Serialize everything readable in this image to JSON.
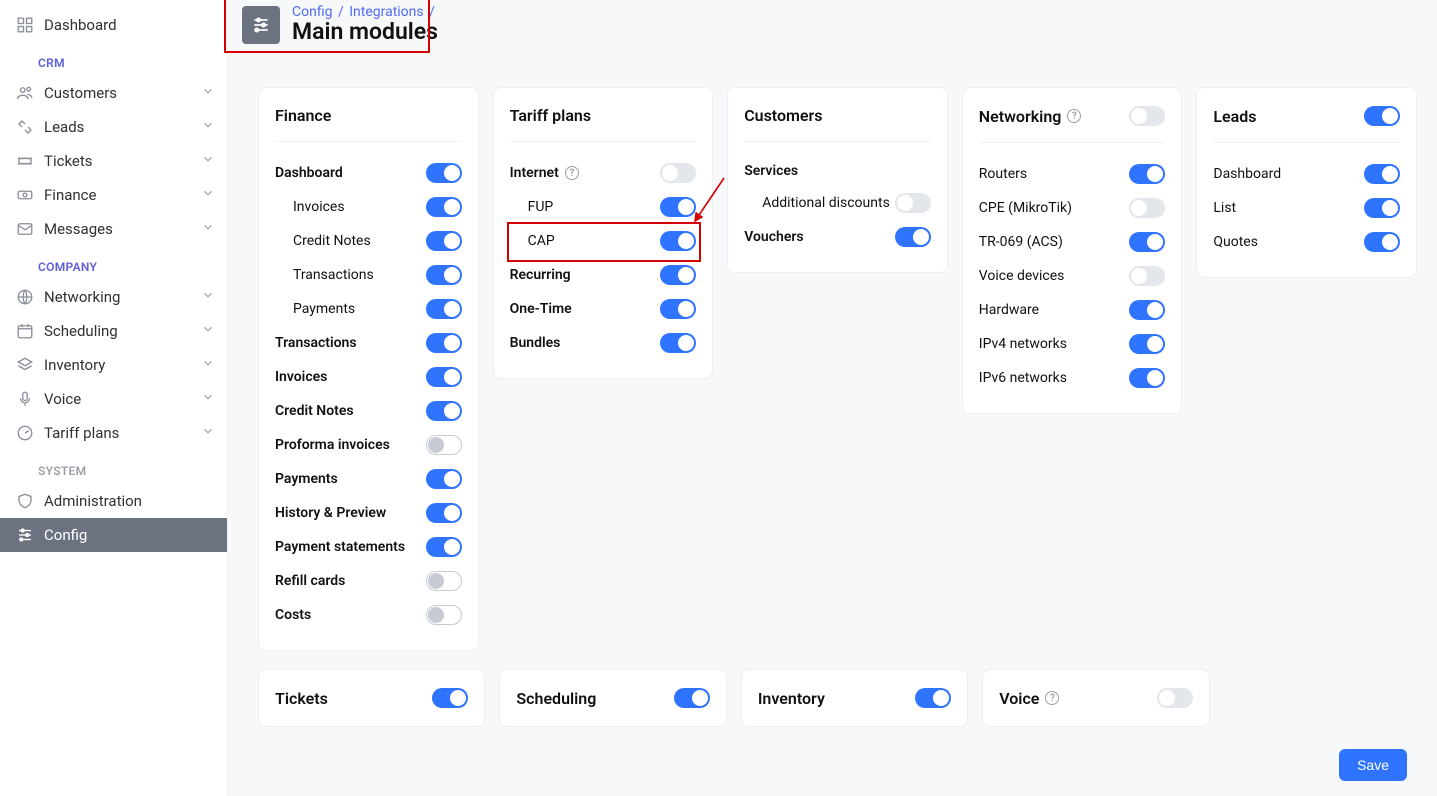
{
  "sidebar": {
    "top": {
      "label": "Dashboard"
    },
    "sections": [
      {
        "label": "CRM",
        "muted": false,
        "items": [
          {
            "label": "Customers",
            "chev": true,
            "icon": "users"
          },
          {
            "label": "Leads",
            "chev": true,
            "icon": "handshake"
          },
          {
            "label": "Tickets",
            "chev": true,
            "icon": "ticket"
          },
          {
            "label": "Finance",
            "chev": true,
            "icon": "money"
          },
          {
            "label": "Messages",
            "chev": true,
            "icon": "mail"
          }
        ]
      },
      {
        "label": "COMPANY",
        "muted": false,
        "items": [
          {
            "label": "Networking",
            "chev": true,
            "icon": "globe"
          },
          {
            "label": "Scheduling",
            "chev": true,
            "icon": "calendar"
          },
          {
            "label": "Inventory",
            "chev": true,
            "icon": "layers"
          },
          {
            "label": "Voice",
            "chev": true,
            "icon": "mic"
          },
          {
            "label": "Tariff plans",
            "chev": true,
            "icon": "gauge"
          }
        ]
      },
      {
        "label": "SYSTEM",
        "muted": true,
        "items": [
          {
            "label": "Administration",
            "chev": false,
            "icon": "shield"
          },
          {
            "label": "Config",
            "chev": false,
            "icon": "sliders",
            "active": true
          }
        ]
      }
    ]
  },
  "header": {
    "breadcrumb": [
      "Config",
      "Integrations"
    ],
    "title": "Main modules"
  },
  "cards": {
    "finance": {
      "title": "Finance",
      "items": [
        {
          "label": "Dashboard",
          "on": true,
          "indent": 0,
          "bold": true
        },
        {
          "label": "Invoices",
          "on": true,
          "indent": 1
        },
        {
          "label": "Credit Notes",
          "on": true,
          "indent": 1
        },
        {
          "label": "Transactions",
          "on": true,
          "indent": 1
        },
        {
          "label": "Payments",
          "on": true,
          "indent": 1
        },
        {
          "label": "Transactions",
          "on": true,
          "indent": 0,
          "bold": true
        },
        {
          "label": "Invoices",
          "on": true,
          "indent": 0,
          "bold": true
        },
        {
          "label": "Credit Notes",
          "on": true,
          "indent": 0,
          "bold": true
        },
        {
          "label": "Proforma invoices",
          "on": false,
          "outline": true,
          "indent": 0,
          "bold": true
        },
        {
          "label": "Payments",
          "on": true,
          "indent": 0,
          "bold": true
        },
        {
          "label": "History & Preview",
          "on": true,
          "indent": 0,
          "bold": true
        },
        {
          "label": "Payment statements",
          "on": true,
          "indent": 0,
          "bold": true
        },
        {
          "label": "Refill cards",
          "on": false,
          "outline": true,
          "indent": 0,
          "bold": true
        },
        {
          "label": "Costs",
          "on": false,
          "outline": true,
          "indent": 0,
          "bold": true
        }
      ]
    },
    "tariff": {
      "title": "Tariff plans",
      "items": [
        {
          "label": "Internet",
          "on": false,
          "indent": 0,
          "bold": true,
          "help": true
        },
        {
          "label": "FUP",
          "on": true,
          "indent": 1
        },
        {
          "label": "CAP",
          "on": true,
          "indent": 1,
          "highlight": true
        },
        {
          "label": "Recurring",
          "on": true,
          "indent": 0,
          "bold": true
        },
        {
          "label": "One-Time",
          "on": true,
          "indent": 0,
          "bold": true
        },
        {
          "label": "Bundles",
          "on": true,
          "indent": 0,
          "bold": true
        }
      ]
    },
    "customers": {
      "title": "Customers",
      "items": [
        {
          "label": "Services",
          "indent": 0,
          "bold": true,
          "notoggle": true
        },
        {
          "label": "Additional discounts",
          "on": false,
          "indent": 1
        },
        {
          "label": "Vouchers",
          "on": true,
          "indent": 0,
          "bold": true
        }
      ]
    },
    "networking": {
      "title": "Networking",
      "help": true,
      "headerToggle": false,
      "items": [
        {
          "label": "Routers",
          "on": true
        },
        {
          "label": "CPE (MikroTik)",
          "on": false
        },
        {
          "label": "TR-069 (ACS)",
          "on": true
        },
        {
          "label": "Voice devices",
          "on": false
        },
        {
          "label": "Hardware",
          "on": true
        },
        {
          "label": "IPv4 networks",
          "on": true
        },
        {
          "label": "IPv6 networks",
          "on": true
        }
      ]
    },
    "leads": {
      "title": "Leads",
      "headerToggle": true,
      "items": [
        {
          "label": "Dashboard",
          "on": true
        },
        {
          "label": "List",
          "on": true
        },
        {
          "label": "Quotes",
          "on": true
        }
      ]
    }
  },
  "smallcards": [
    {
      "title": "Tickets",
      "on": true
    },
    {
      "title": "Scheduling",
      "on": true
    },
    {
      "title": "Inventory",
      "on": true
    },
    {
      "title": "Voice",
      "on": false,
      "help": true
    }
  ],
  "footer": {
    "save": "Save"
  }
}
